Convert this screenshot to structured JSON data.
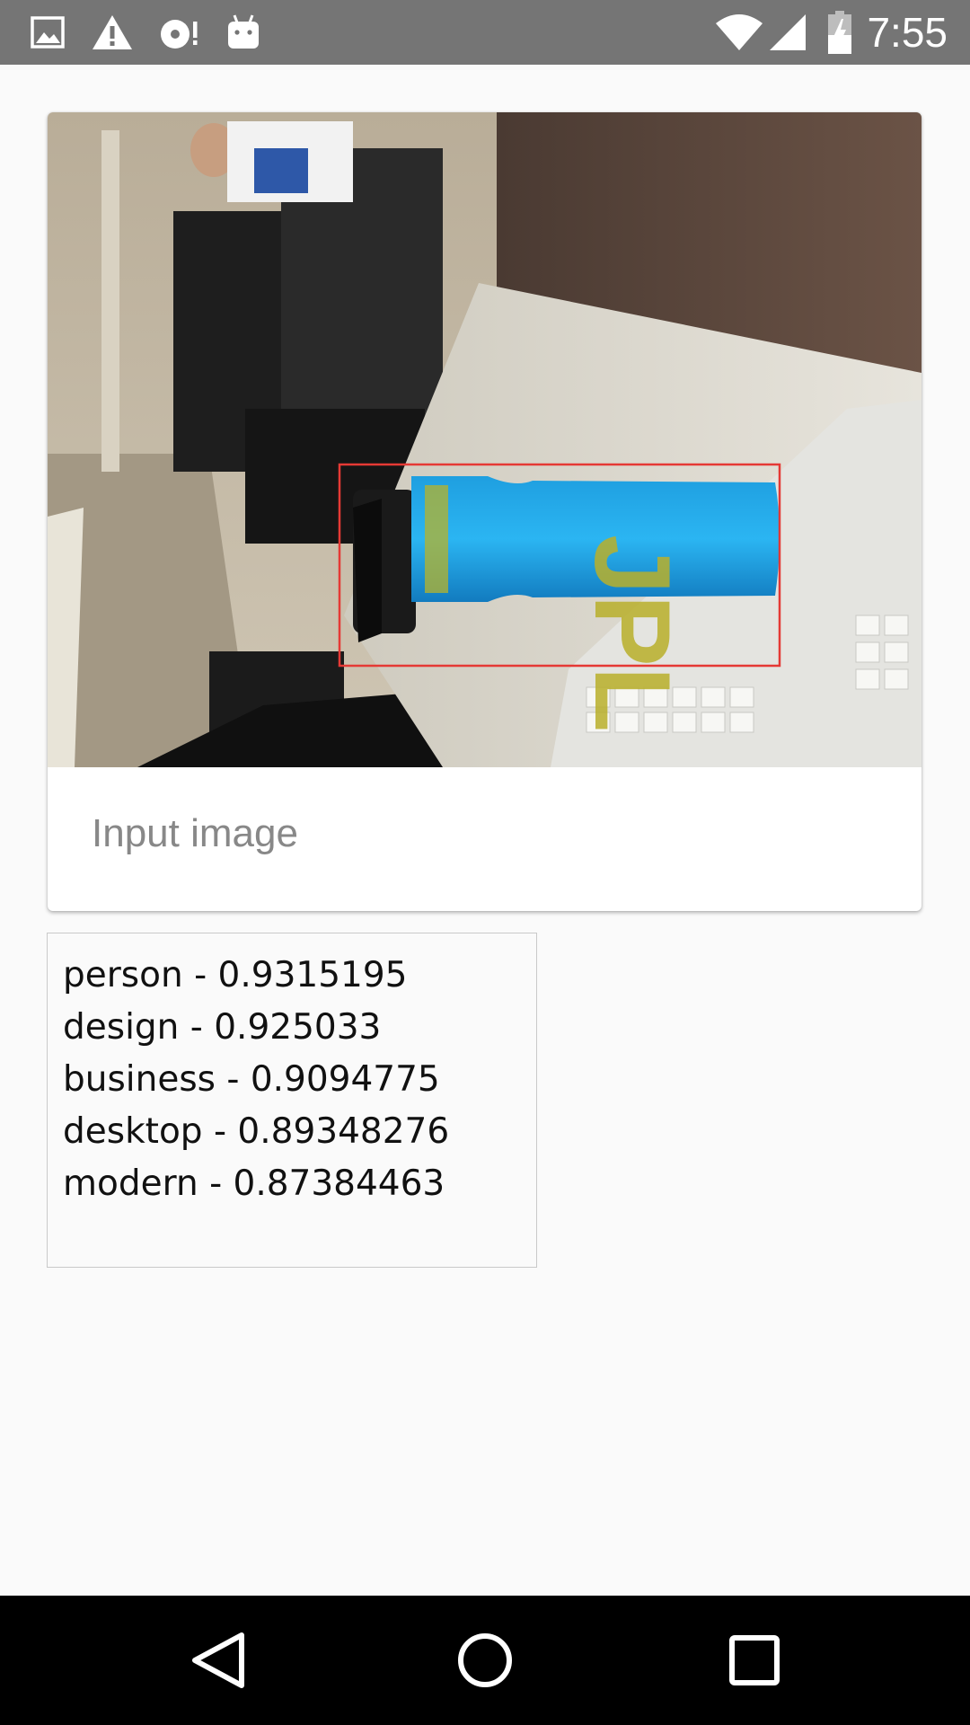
{
  "status_bar": {
    "time": "7:55",
    "icons_left": [
      "image-icon",
      "warning-icon",
      "disc-icon",
      "android-icon"
    ],
    "icons_right": [
      "wifi-icon",
      "signal-icon",
      "battery-charging-icon"
    ]
  },
  "card": {
    "caption": "Input image",
    "image_description": "photo of a blue water bottle on a white desk with a red detection box around it"
  },
  "results": {
    "lines": [
      "person - 0.9315195",
      "design - 0.925033",
      "business - 0.9094775",
      "desktop - 0.89348276",
      "modern - 0.87384463"
    ]
  },
  "nav_bar": {
    "buttons": [
      "back-icon",
      "home-icon",
      "recents-icon"
    ]
  },
  "colors": {
    "status_bar": "#757575",
    "background": "#fafafa",
    "caption_text": "#888888",
    "detection_box": "#e53935"
  }
}
